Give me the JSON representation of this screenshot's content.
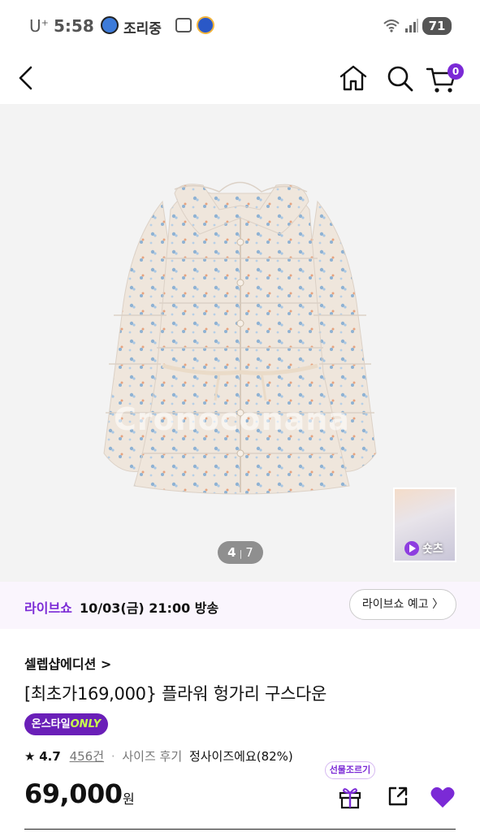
{
  "status_bar": {
    "carrier": "U",
    "carrier_sup": "+",
    "time": "5:58",
    "cooking_label": "조리중",
    "battery": "71"
  },
  "nav": {
    "back_icon": "chevron-left-icon",
    "home_icon": "home-icon",
    "search_icon": "search-icon",
    "cart_icon": "cart-icon",
    "cart_count": "0",
    "accent_color": "#7b2ad6"
  },
  "gallery": {
    "watermark": "Cronoconana",
    "current": "4",
    "total": "7",
    "separator": "|",
    "shorts_label": "숏츠",
    "shorts_icon": "play-icon"
  },
  "live_show": {
    "label": "라이브쇼",
    "datetime": "10/03(금) 21:00 방송",
    "button_label": "라이브쇼 예고 〉"
  },
  "product": {
    "brand": "셀렙샵에디션 >",
    "title": "[최초가169,000} 플라워 헝가리 구스다운",
    "badge_prefix": "온스타일",
    "badge_suffix": "ONLY",
    "rating": "4.7",
    "review_count": "456건",
    "size_review_label": "사이즈 후기",
    "size_review_value": "정사이즈에요(82%)",
    "price": "69,000",
    "price_unit": "원",
    "gift_tooltip": "선물조르기",
    "gift_icon": "gift-icon",
    "share_icon": "share-icon",
    "heart_icon": "heart-icon"
  }
}
